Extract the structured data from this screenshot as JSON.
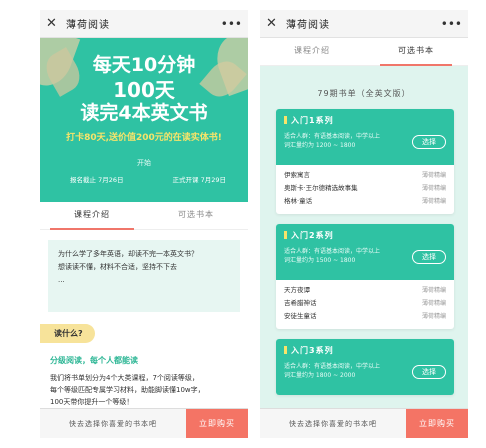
{
  "left": {
    "titlebar": {
      "close": "✕",
      "title": "薄荷阅读",
      "more": "•••"
    },
    "banner": {
      "line1": "每天10分钟",
      "line2": "100天",
      "line3": "读完4本英文书",
      "promo": "打卡80天,送价值200元的在读实体书!",
      "tag": "开始",
      "date_start": "报名截止 7月26日",
      "date_end": "正式开课 7月29日"
    },
    "tabs": [
      "课程介绍",
      "可选书本"
    ],
    "intro": {
      "q1": "为什么学了多年英语，却读不完一本英文书？",
      "q2": "想读读不懂，材料不合适，坚持不下去",
      "q3": "..."
    },
    "why_label": "读什么?",
    "sub_heading": "分级阅读，每个人都能读",
    "desc": [
      "我们将书单划分为4个大类课程，7个阅读等级，",
      "每个等级匹配专属学习材料，助能脚读懂10w字，",
      "100天带你提升一个等级！"
    ],
    "bottom": {
      "hint": "快去选择你喜爱的书本吧",
      "cta": "立即购买"
    }
  },
  "right": {
    "titlebar": {
      "close": "✕",
      "title": "薄荷阅读",
      "more": "•••"
    },
    "tabs": [
      "课程介绍",
      "可选书本"
    ],
    "section_head": "79期书单（全英文版）",
    "cards": [
      {
        "name": "入门1系列",
        "info1": "适合人群：有语基本阅读，中学以上",
        "info2": "词汇量约为 1200 ~ 1800",
        "pick": "选择",
        "books": [
          {
            "title": "伊索寓言",
            "level": "薄荷精编"
          },
          {
            "title": "奥斯卡·王尔德精选故事集",
            "level": "薄荷精编"
          },
          {
            "title": "格林·童话",
            "level": "薄荷精编"
          }
        ]
      },
      {
        "name": "入门2系列",
        "info1": "适合人群：有语基本阅读，中学以上",
        "info2": "词汇量约为 1500 ~ 1800",
        "pick": "选择",
        "books": [
          {
            "title": "天方夜谭",
            "level": "薄荷精编"
          },
          {
            "title": "吉希腊神话",
            "level": "薄荷精编"
          },
          {
            "title": "安徒生童话",
            "level": "薄荷精编"
          }
        ]
      },
      {
        "name": "入门3系列",
        "info1": "适合人群：有语基本阅读，中学以上",
        "info2": "词汇量约为 1800 ~ 2000",
        "pick": "选择",
        "books": []
      }
    ],
    "bottom": {
      "hint": "快去选择你喜爱的书本吧",
      "cta": "立即购买"
    }
  },
  "colors": {
    "brand_green": "#2fc2a3",
    "accent_red": "#f47465",
    "promo_yellow": "#f7e46a",
    "light_mint": "#dff4ee"
  }
}
